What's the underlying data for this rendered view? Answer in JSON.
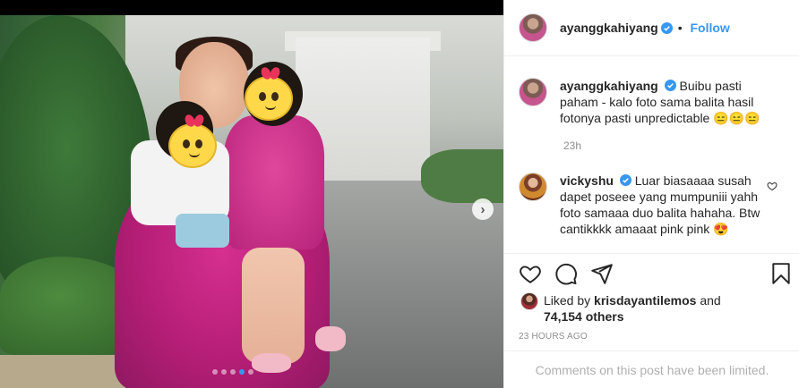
{
  "post": {
    "author": "ayanggkahiyang",
    "follow_sep": "•",
    "follow_label": "Follow",
    "carousel": {
      "current_index": 4,
      "total": 5
    }
  },
  "comments": [
    {
      "username": "ayanggkahiyang",
      "verified": true,
      "text": "Buibu pasti paham - kalo foto sama balita hasil fotonya pasti unpredictable 😑😑😑",
      "time": "23h"
    },
    {
      "username": "vickyshu",
      "verified": true,
      "text": "Luar biasaaaa susah dapet poseee yang mumpuniii yahh foto samaaa duo balita hahaha. Btw cantikkkk amaaat pink pink 😍"
    }
  ],
  "likes": {
    "prefix": "Liked by",
    "liker": "krisdayantilemos",
    "conj": "and",
    "count": "74,154 others"
  },
  "time_ago": "23 HOURS AGO",
  "comments_limited": "Comments on this post have been limited.",
  "icons": {
    "verified": "verified-badge-icon",
    "like": "heart-icon",
    "comment": "comment-icon",
    "share": "share-icon",
    "save": "bookmark-icon",
    "next": "chevron-right-icon"
  },
  "colors": {
    "accent": "#3897f0",
    "text": "#262626",
    "muted": "#8e8e8e"
  }
}
